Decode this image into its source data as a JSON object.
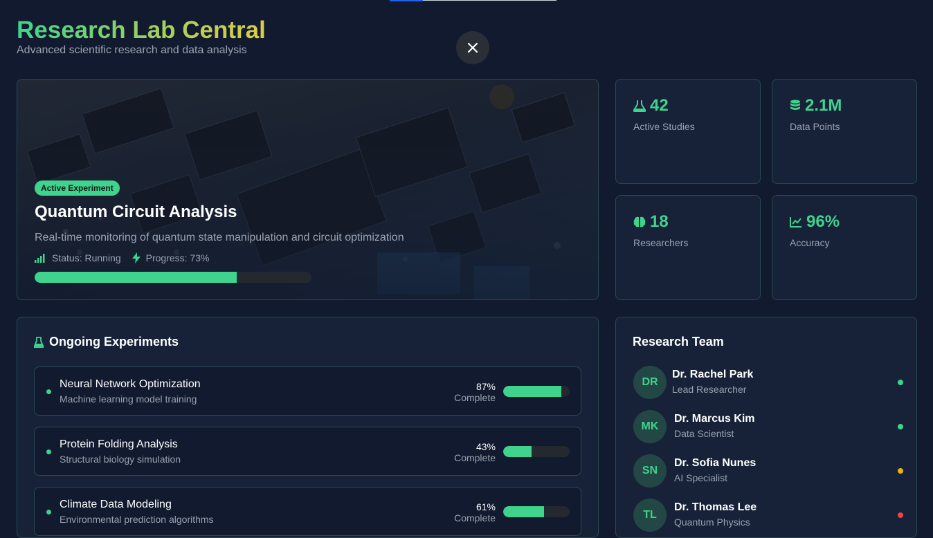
{
  "app": {
    "title": "Research Lab Central",
    "subtitle": "Advanced scientific research and data analysis"
  },
  "hero": {
    "badge": "Active Experiment",
    "title": "Quantum Circuit Analysis",
    "description": "Real-time monitoring of quantum state manipulation and circuit optimization",
    "status_label": "Status: Running",
    "progress_label": "Progress: 73%",
    "progress_value": 0.73
  },
  "stats": [
    {
      "icon": "flask-icon",
      "value": "42",
      "label": "Active Studies"
    },
    {
      "icon": "database-icon",
      "value": "2.1M",
      "label": "Data Points"
    },
    {
      "icon": "brain-icon",
      "value": "18",
      "label": "Researchers"
    },
    {
      "icon": "chart-line-icon",
      "value": "96%",
      "label": "Accuracy"
    }
  ],
  "experiments": {
    "title": "Ongoing Experiments",
    "complete_label": "Complete",
    "items": [
      {
        "name": "Neural Network Optimization",
        "sub": "Machine learning model training",
        "pct": "87%",
        "value": 0.87
      },
      {
        "name": "Protein Folding Analysis",
        "sub": "Structural biology simulation",
        "pct": "43%",
        "value": 0.43
      },
      {
        "name": "Climate Data Modeling",
        "sub": "Environmental prediction algorithms",
        "pct": "61%",
        "value": 0.61
      }
    ]
  },
  "team": {
    "title": "Research Team",
    "members": [
      {
        "initials": "DR",
        "name": "Dr. Rachel Park",
        "role": "Lead Researcher",
        "status_color": "#3fd38d"
      },
      {
        "initials": "MK",
        "name": "Dr. Marcus Kim",
        "role": "Data Scientist",
        "status_color": "#3fd38d"
      },
      {
        "initials": "SN",
        "name": "Dr. Sofia Nunes",
        "role": "AI Specialist",
        "status_color": "#eab308"
      },
      {
        "initials": "TL",
        "name": "Dr. Thomas Lee",
        "role": "Quantum Physics",
        "status_color": "#ef4444"
      }
    ]
  },
  "colors": {
    "accent": "#3fd38d",
    "background": "#111a2e",
    "card": "#172238"
  }
}
